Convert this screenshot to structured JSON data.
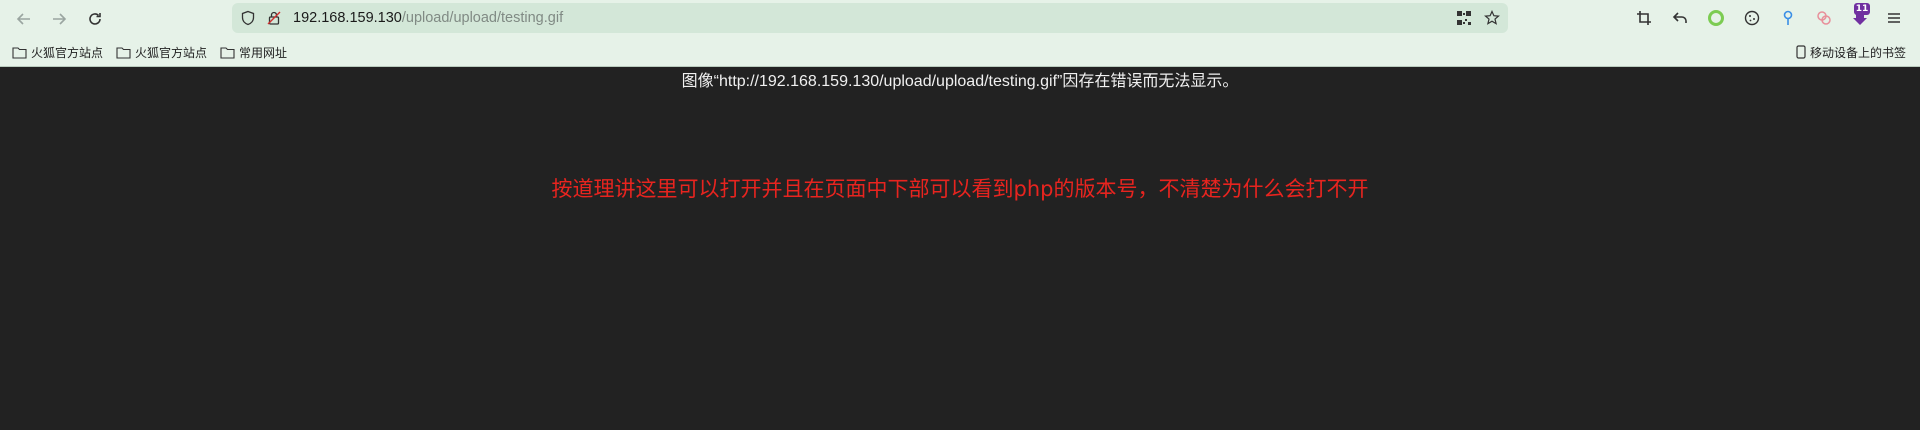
{
  "nav": {
    "back_icon": "back-arrow-icon",
    "forward_icon": "forward-arrow-icon",
    "reload_icon": "reload-icon"
  },
  "urlbar": {
    "host": "192.168.159.130",
    "path": "/upload/upload/testing.gif"
  },
  "toolbar": {
    "downloads_badge": "11"
  },
  "bookmarks": {
    "items": [
      {
        "label": "火狐官方站点"
      },
      {
        "label": "火狐官方站点"
      },
      {
        "label": "常用网址"
      }
    ],
    "mobile_label": "移动设备上的书签"
  },
  "content": {
    "error_message": "图像“http://192.168.159.130/upload/upload/testing.gif”因存在错误而无法显示。",
    "annotation": "按道理讲这里可以打开并且在页面中下部可以看到php的版本号，不清楚为什么会打不开"
  },
  "colors": {
    "chrome_bg": "#e6f2e8",
    "content_bg": "#222222",
    "annotation": "#e8241f"
  }
}
